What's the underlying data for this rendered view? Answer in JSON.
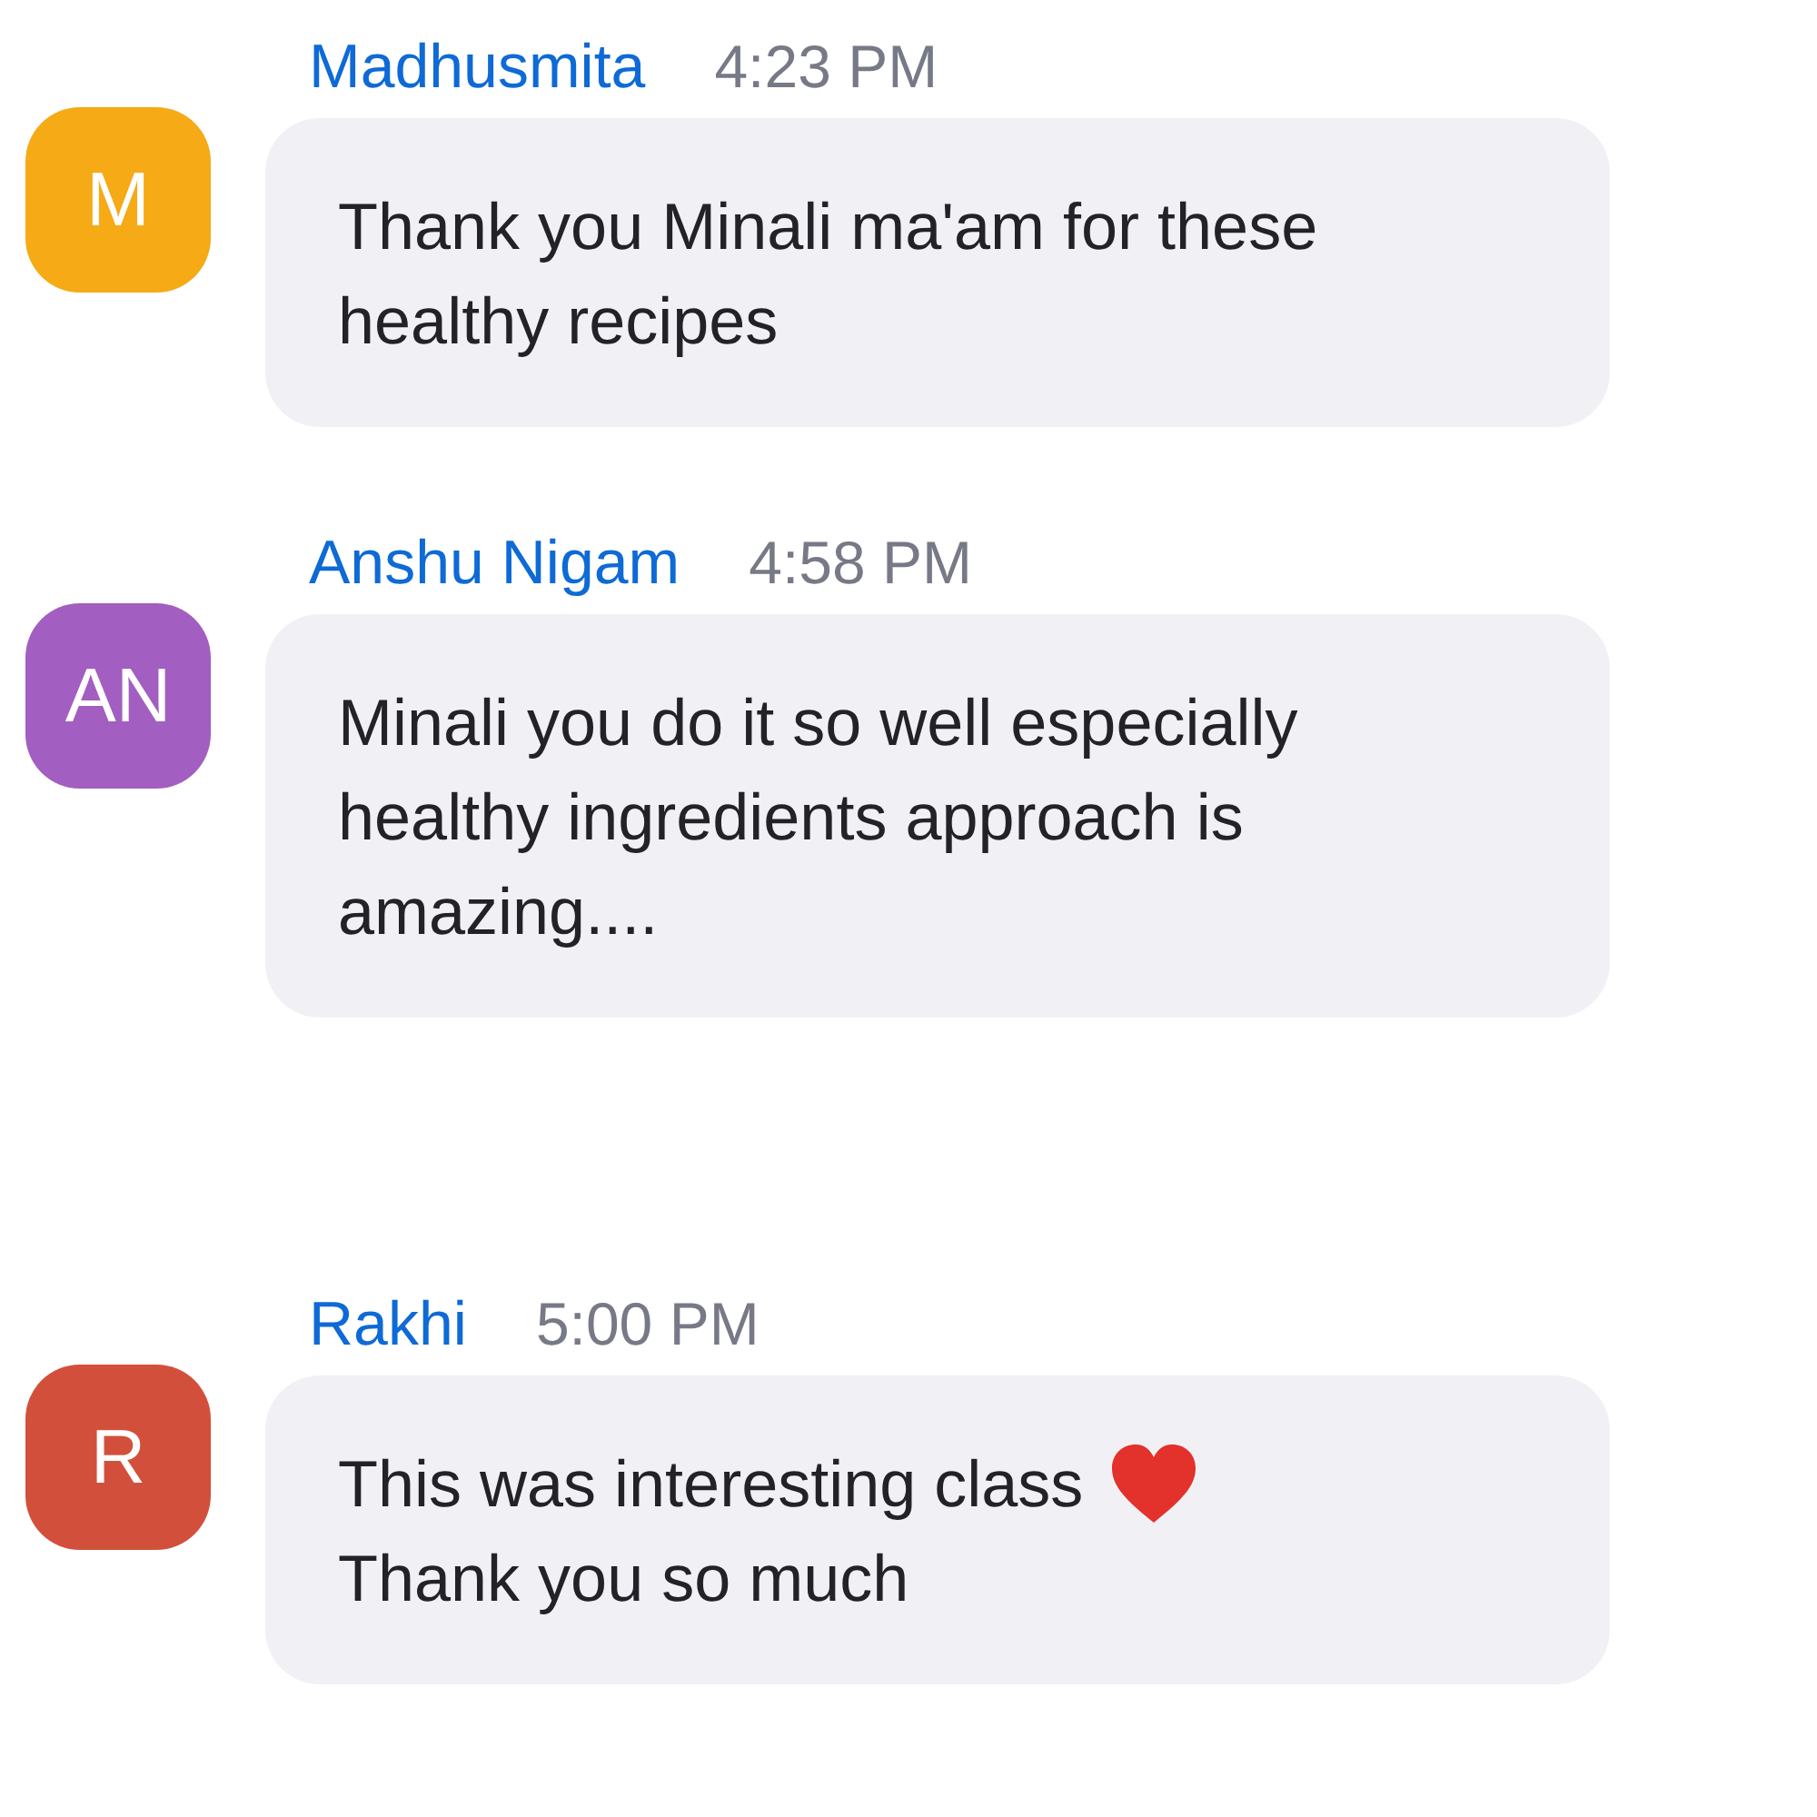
{
  "messages": [
    {
      "sender": "Madhusmita",
      "initials": "M",
      "color": "#f5aa16",
      "time": "4:23 PM",
      "lines": [
        {
          "text": "Thank you Minali ma'am for these",
          "heart": false
        },
        {
          "text": "healthy recipes",
          "heart": false
        }
      ]
    },
    {
      "sender": "Anshu Nigam",
      "initials": "AN",
      "color": "#a25ec0",
      "time": "4:58 PM",
      "lines": [
        {
          "text": "Minali you do it so well especially",
          "heart": false
        },
        {
          "text": "healthy ingredients approach is",
          "heart": false
        },
        {
          "text": "amazing....",
          "heart": false
        }
      ]
    },
    {
      "sender": "Rakhi",
      "initials": "R",
      "color": "#d2503b",
      "time": "5:00 PM",
      "lines": [
        {
          "text": "This was interesting class",
          "heart": true
        },
        {
          "text": "Thank you so much",
          "heart": false
        }
      ]
    }
  ]
}
